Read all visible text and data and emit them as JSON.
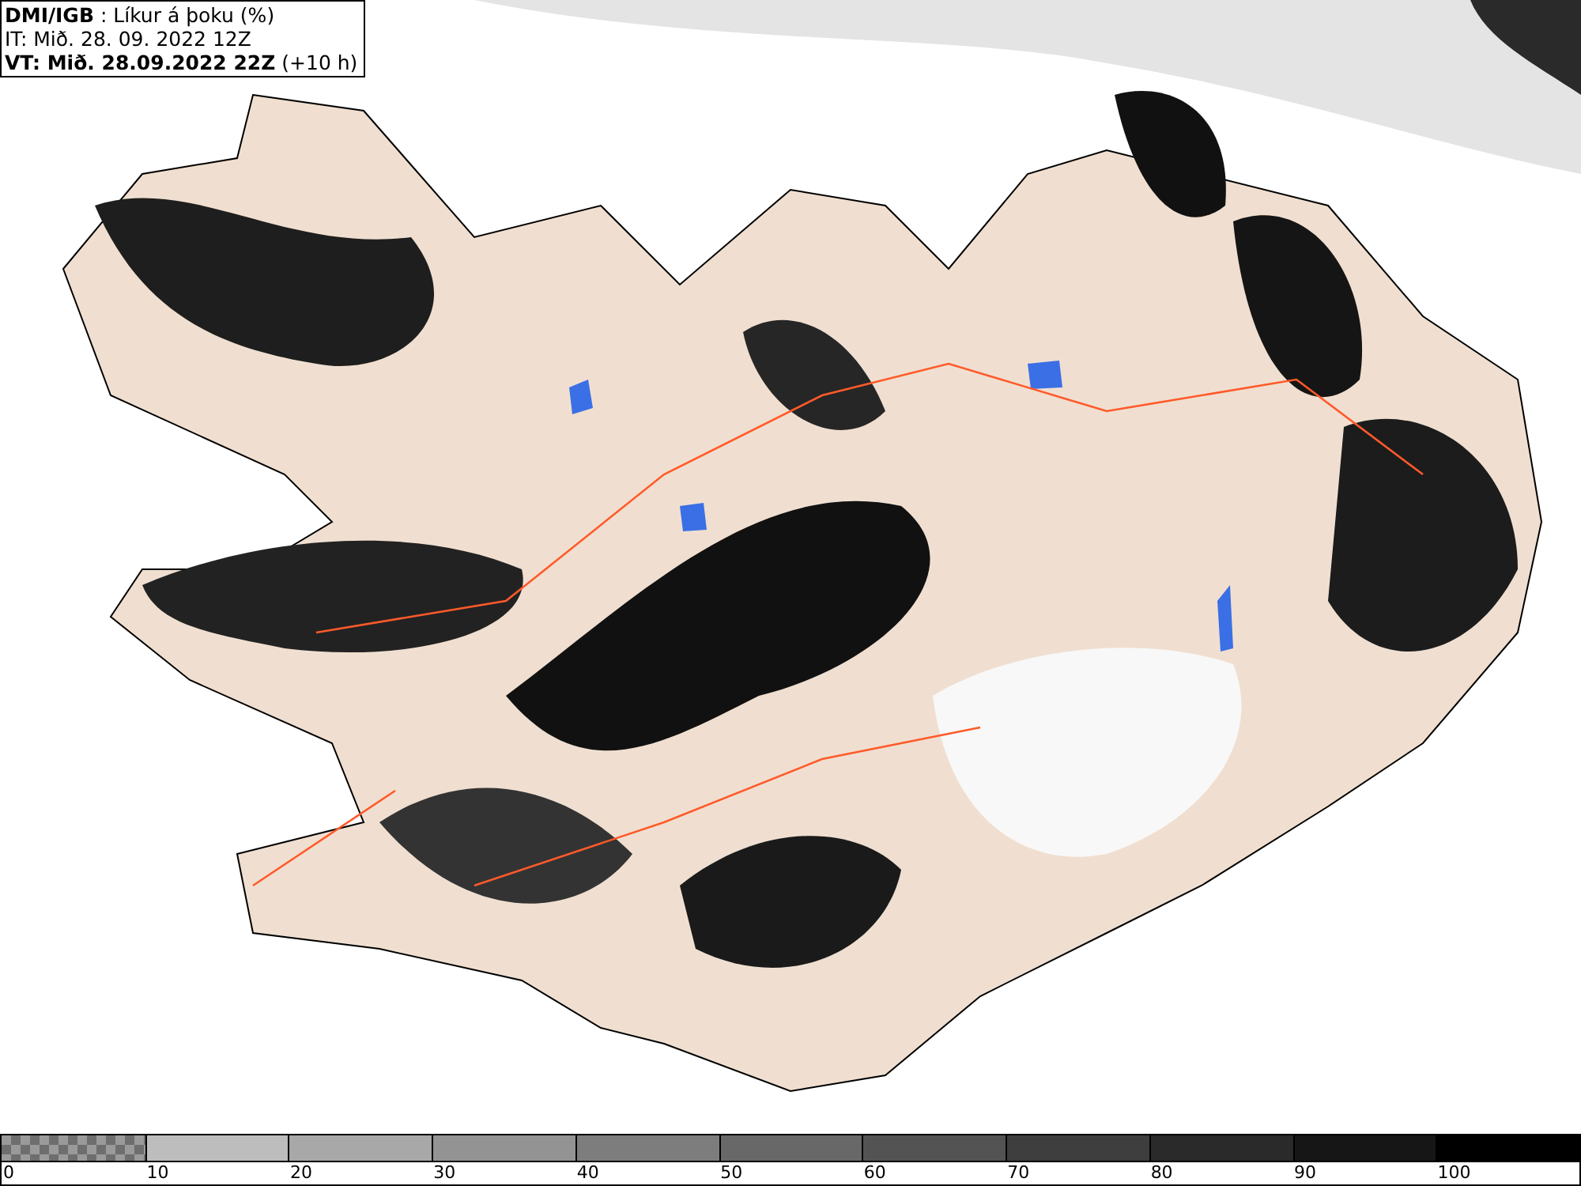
{
  "header": {
    "lines": [
      "**DMI/IGB** : Líkur á þoku (%)",
      "IT: Mið. 28. 09. 2022 12Z",
      "**VT: Mið. 28.09.2022 22Z** (+10 h)"
    ]
  },
  "legend": {
    "bins": [
      {
        "kind": "checkered",
        "color": "#6e6e6e"
      },
      {
        "kind": "solid",
        "color": "#bdbdbd"
      },
      {
        "kind": "solid",
        "color": "#a8a8a8"
      },
      {
        "kind": "solid",
        "color": "#939393"
      },
      {
        "kind": "solid",
        "color": "#7d7d7d"
      },
      {
        "kind": "solid",
        "color": "#686868"
      },
      {
        "kind": "solid",
        "color": "#535353"
      },
      {
        "kind": "solid",
        "color": "#3e3e3e"
      },
      {
        "kind": "solid",
        "color": "#2a2a2a"
      },
      {
        "kind": "solid",
        "color": "#161616"
      },
      {
        "kind": "solid",
        "color": "#000000"
      }
    ],
    "labels": [
      "0",
      "10",
      "20",
      "30",
      "40",
      "50",
      "60",
      "70",
      "80",
      "90",
      "100"
    ]
  }
}
